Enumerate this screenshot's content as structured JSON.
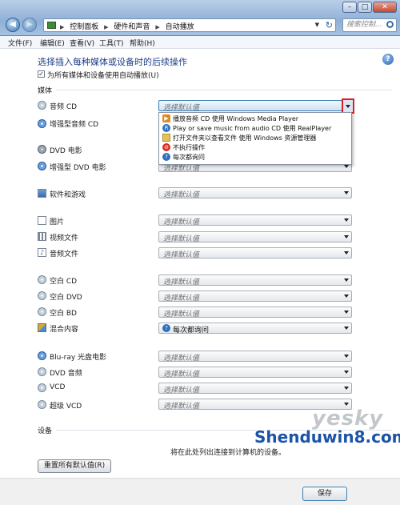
{
  "window": {
    "controls": [
      "–",
      "□",
      "✕"
    ]
  },
  "address": {
    "crumbs": [
      "控制面板",
      "硬件和声音",
      "自动播放"
    ],
    "search_placeholder": "搜索控制..."
  },
  "menu": [
    "文件(F)",
    "编辑(E)",
    "查看(V)",
    "工具(T)",
    "帮助(H)"
  ],
  "page": {
    "title": "选择插入每种媒体或设备时的后续操作",
    "checkbox_label": "为所有媒体和设备使用自动播放(U)",
    "checkbox_checked": true,
    "media_section": "媒体",
    "devices_section": "设备",
    "devices_note": "将在此处列出连接到计算机的设备。",
    "reset_button": "重置所有默认值(R)",
    "ok_button": "保存"
  },
  "rows": [
    {
      "icon": "audio-cd-icon",
      "label": "音频 CD",
      "value": "选择默认值",
      "open": true
    },
    {
      "icon": "enhanced-audio-cd-icon",
      "label": "增强型音频 CD",
      "value": "选择默认值"
    },
    {
      "icon": "dvd-icon",
      "label": "DVD 电影",
      "value": "选择默认值"
    },
    {
      "icon": "enhanced-dvd-icon",
      "label": "增强型 DVD 电影",
      "value": "选择默认值"
    },
    {
      "icon": "software-icon",
      "label": "软件和游戏",
      "value": "选择默认值"
    },
    {
      "icon": "picture-icon",
      "label": "图片",
      "value": "选择默认值"
    },
    {
      "icon": "video-file-icon",
      "label": "视频文件",
      "value": "选择默认值"
    },
    {
      "icon": "audio-file-icon",
      "label": "音频文件",
      "value": "选择默认值"
    },
    {
      "icon": "blank-cd-icon",
      "label": "空白 CD",
      "value": "选择默认值"
    },
    {
      "icon": "blank-dvd-icon",
      "label": "空白 DVD",
      "value": "选择默认值"
    },
    {
      "icon": "blank-bd-icon",
      "label": "空白 BD",
      "value": "选择默认值"
    },
    {
      "icon": "mixed-content-icon",
      "label": "混合内容",
      "value": "每次都询问"
    },
    {
      "icon": "bluray-icon",
      "label": "Blu-ray 光盘电影",
      "value": "选择默认值"
    },
    {
      "icon": "dvd-audio-icon",
      "label": "DVD 音频",
      "value": "选择默认值"
    },
    {
      "icon": "vcd-icon",
      "label": "VCD",
      "value": "选择默认值"
    },
    {
      "icon": "svcd-icon",
      "label": "超级 VCD",
      "value": "选择默认值"
    }
  ],
  "popup_options": [
    {
      "icon": "play-icon",
      "label": "播放音频 CD 使用 Windows Media Player"
    },
    {
      "icon": "realplayer-icon",
      "label": "Play or save music from audio CD 使用 RealPlayer"
    },
    {
      "icon": "folder-icon",
      "label": "打开文件夹以查看文件 使用 Windows 资源管理器"
    },
    {
      "icon": "no-action-icon",
      "label": "不执行操作"
    },
    {
      "icon": "ask-icon",
      "label": "每次都询问"
    }
  ],
  "watermark": {
    "logo": "yesky",
    "site": "Shenduwin8.com"
  },
  "colors": {
    "title_blue": "#1e3e8a",
    "highlight_red": "#e02020"
  }
}
